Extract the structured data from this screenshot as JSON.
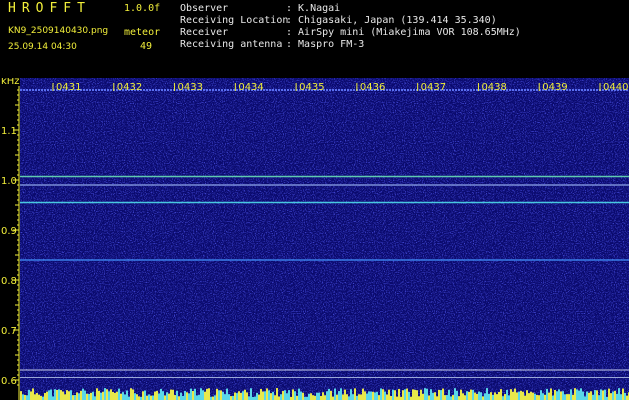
{
  "header": {
    "app_title": "HROFFT",
    "version": "1.0.0f",
    "filename": "KN9_2509140430.png",
    "datetime": "25.09.14 04:30",
    "meteor_label": "meteor",
    "meteor_count": "49"
  },
  "info": [
    {
      "label": "Observer",
      "value": ": K.Nagai"
    },
    {
      "label": "Receiving Location",
      "value": ": Chigasaki, Japan (139.414 35.340)"
    },
    {
      "label": "Receiver",
      "value": ": AirSpy mini (Miakejima VOR 108.65MHz)"
    },
    {
      "label": "Receiving antenna",
      "value": ": Maspro FM-3"
    }
  ],
  "chart_data": {
    "type": "heatmap",
    "ylabel": "kHz",
    "ylim": [
      0.6,
      1.2
    ],
    "y_ticks": [
      "1.1",
      "1.0",
      "0.9",
      "0.8",
      "0.7",
      "0.6"
    ],
    "y_tick_values": [
      1.1,
      1.0,
      0.9,
      0.8,
      0.7,
      0.6
    ],
    "time_labels": [
      "0431",
      "0432",
      "0433",
      "0434",
      "0435",
      "0436",
      "0437",
      "0438",
      "0439",
      "0440"
    ],
    "carrier_lines": [
      {
        "freq": 1.007,
        "color": "#5fc9b0"
      },
      {
        "freq": 0.99,
        "color": "#7a8ed8"
      },
      {
        "freq": 0.955,
        "color": "#48c8e0"
      },
      {
        "freq": 0.84,
        "color": "#3a7ee8"
      },
      {
        "freq": 0.62,
        "color": "#c8d0f0"
      },
      {
        "freq": 0.605,
        "color": "#9aa8d8"
      }
    ],
    "colors": {
      "background": "#0a0a6e",
      "axis": "#f2ef3a",
      "timeline": "#5a6ff0"
    }
  }
}
